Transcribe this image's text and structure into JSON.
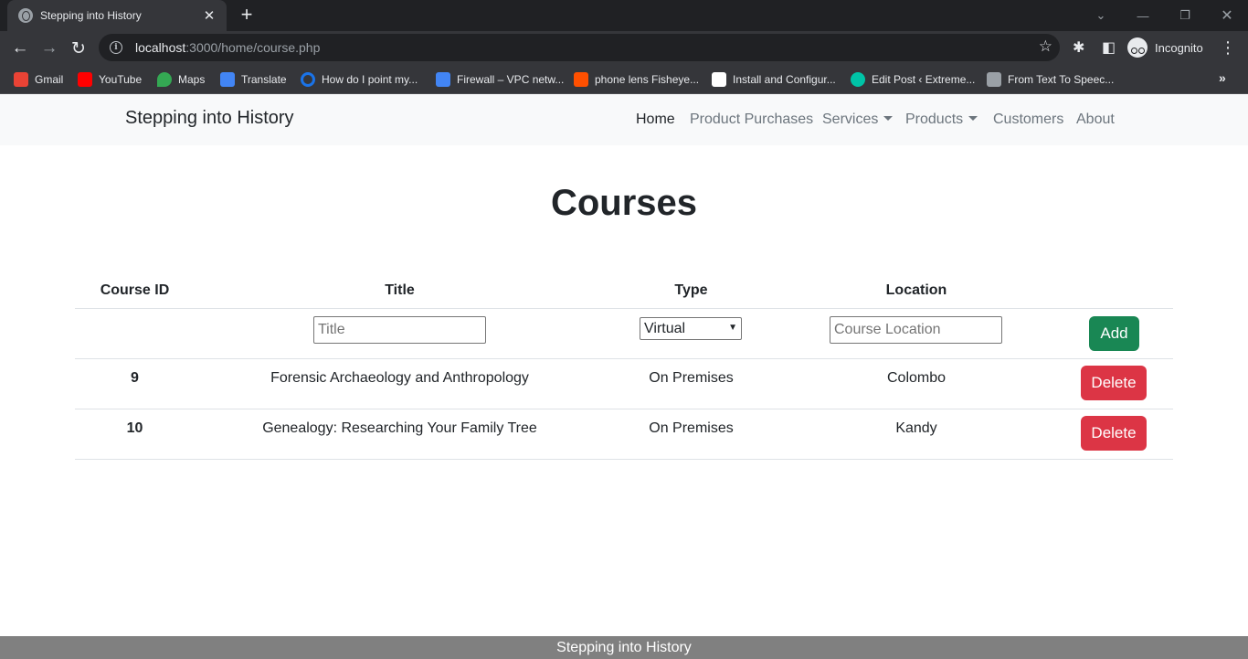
{
  "browser": {
    "tab_title": "Stepping into History",
    "url_host": "localhost",
    "url_path": ":3000/home/course.php",
    "profile_label": "Incognito",
    "bookmarks": [
      {
        "label": "Gmail",
        "color": "#ea4335"
      },
      {
        "label": "YouTube",
        "color": "#ff0000"
      },
      {
        "label": "Maps",
        "color": "#34a853"
      },
      {
        "label": "Translate",
        "color": "#4285f4"
      },
      {
        "label": "How do I point my...",
        "color": "#1a73e8"
      },
      {
        "label": "Firewall – VPC netw...",
        "color": "#4285f4"
      },
      {
        "label": "phone lens Fisheye...",
        "color": "#ff5000"
      },
      {
        "label": "Install and Configur...",
        "color": "#ffffff"
      },
      {
        "label": "Edit Post ‹ Extreme...",
        "color": "#00c4a7"
      },
      {
        "label": "From Text To Speec...",
        "color": "#9aa0a6"
      }
    ]
  },
  "navbar": {
    "brand": "Stepping into History",
    "links": [
      {
        "label": "Home",
        "active": true
      },
      {
        "label": "Product Purchases",
        "active": false
      },
      {
        "label": "Services",
        "dropdown": true
      },
      {
        "label": "Products",
        "dropdown": true
      },
      {
        "label": "Customers",
        "active": false
      },
      {
        "label": "About",
        "active": false
      }
    ]
  },
  "page": {
    "title": "Courses",
    "table": {
      "headers": [
        "Course ID",
        "Title",
        "Type",
        "Location",
        ""
      ],
      "new_row": {
        "title_placeholder": "Title",
        "type_selected": "Virtual",
        "location_placeholder": "Course Location",
        "add_label": "Add"
      },
      "rows": [
        {
          "id": "9",
          "title": "Forensic Archaeology and Anthropology",
          "type": "On Premises",
          "location": "Colombo",
          "action": "Delete"
        },
        {
          "id": "10",
          "title": "Genealogy: Researching Your Family Tree",
          "type": "On Premises",
          "location": "Kandy",
          "action": "Delete"
        }
      ]
    }
  },
  "footer": {
    "text": "Stepping into History"
  }
}
